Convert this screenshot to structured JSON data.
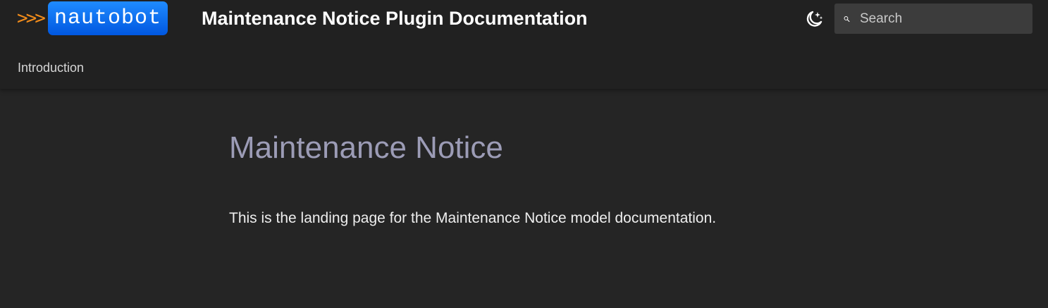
{
  "header": {
    "logo": {
      "chevrons": ">>>",
      "wordmark": "nautobot"
    },
    "title": "Maintenance Notice Plugin Documentation",
    "theme_toggle_icon": "moon-stars-icon",
    "search": {
      "placeholder": "Search",
      "value": "",
      "icon": "search-icon"
    }
  },
  "tabs": [
    {
      "label": "Introduction"
    }
  ],
  "main": {
    "heading": "Maintenance Notice",
    "paragraph": "This is the landing page for the Maintenance Notice model documentation."
  },
  "colors": {
    "header_bg": "#212121",
    "page_bg": "#252525",
    "logo_orange": "#f28c1b",
    "logo_blue": "#0a6cff",
    "heading": "#9c9cb6",
    "search_bg": "#3c3c3c"
  }
}
